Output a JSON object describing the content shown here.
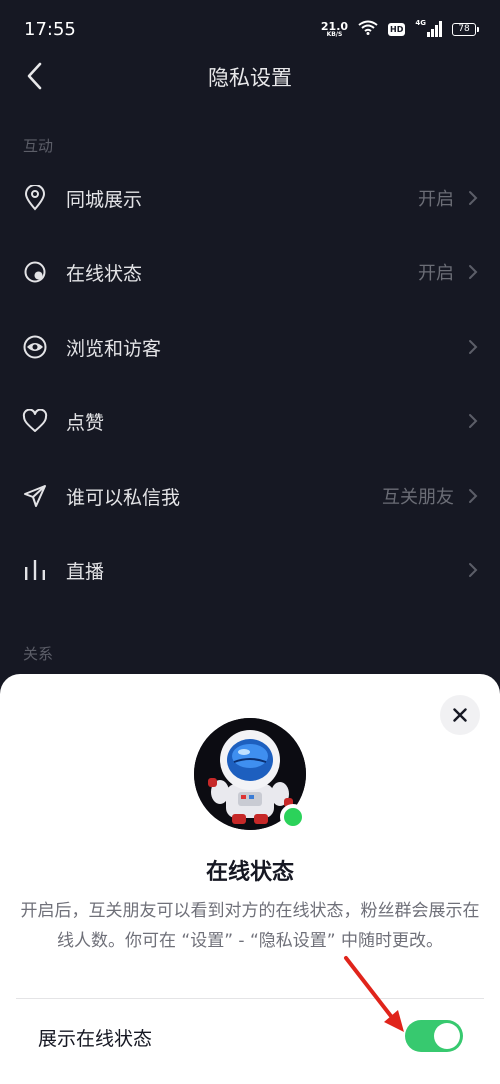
{
  "status_bar": {
    "time": "17:55",
    "net_speed_value": "21.0",
    "net_speed_unit": "KB/S",
    "hd_badge": "HD",
    "signal_label": "4G",
    "battery": "78"
  },
  "header": {
    "title": "隐私设置"
  },
  "sections": {
    "interaction": "互动",
    "relations": "关系"
  },
  "rows": [
    {
      "icon": "location-pin-icon",
      "label": "同城展示",
      "value": "开启"
    },
    {
      "icon": "online-status-icon",
      "label": "在线状态",
      "value": "开启"
    },
    {
      "icon": "eye-icon",
      "label": "浏览和访客",
      "value": ""
    },
    {
      "icon": "heart-icon",
      "label": "点赞",
      "value": ""
    },
    {
      "icon": "send-icon",
      "label": "谁可以私信我",
      "value": "互关朋友"
    },
    {
      "icon": "live-bars-icon",
      "label": "直播",
      "value": ""
    }
  ],
  "sheet": {
    "title": "在线状态",
    "description": "开启后，互关朋友可以看到对方的在线状态，粉丝群会展示在线人数。你可在 “设置” - “隐私设置” 中随时更改。",
    "toggle_label": "展示在线状态",
    "toggle_on": true
  },
  "colors": {
    "background": "#161823",
    "sheet": "#ffffff",
    "toggle_on": "#37c96f",
    "online_dot": "#2bd25a",
    "annotation_arrow": "#e0241b"
  }
}
